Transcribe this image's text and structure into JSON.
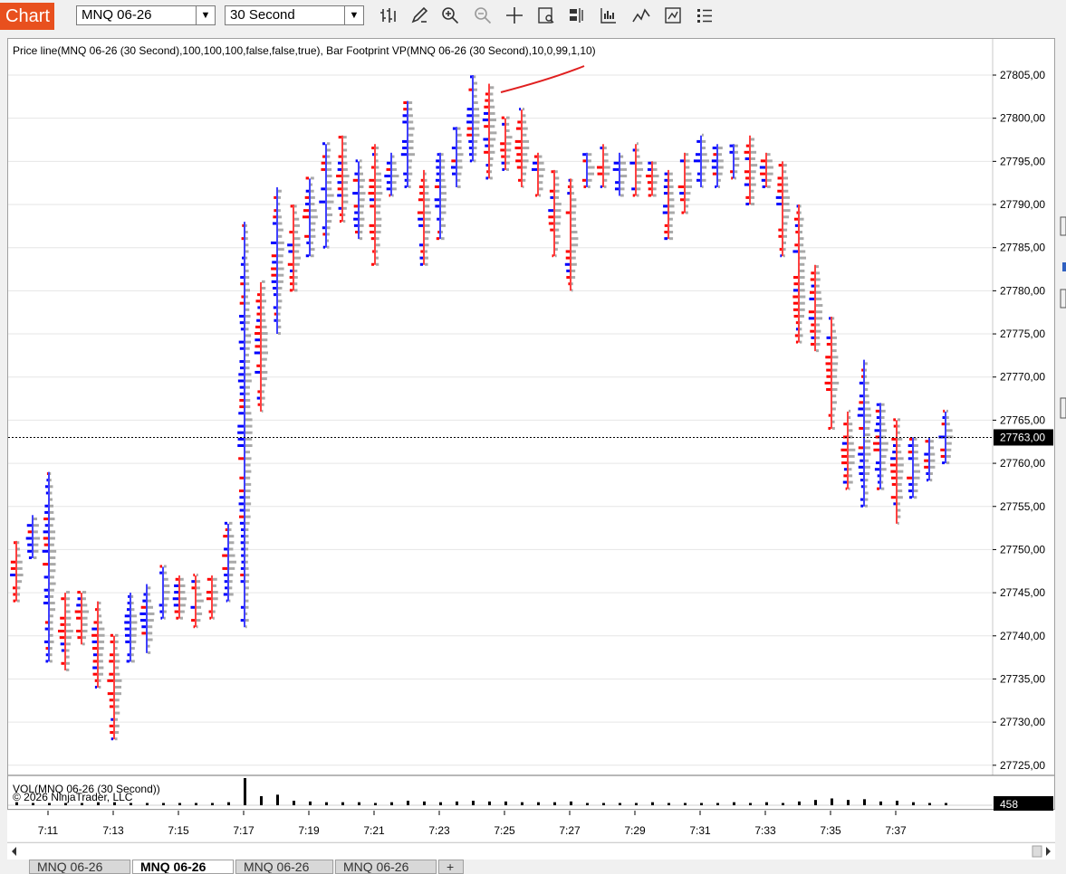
{
  "toolbar": {
    "chart_tab": "Chart",
    "instrument": "MNQ 06-26",
    "interval": "30 Second"
  },
  "indicator_label": "Price line(MNQ 06-26 (30 Second),100,100,100,false,false,true), Bar Footprint VP(MNQ 06-26 (30 Second),10,0,99,1,10)",
  "volume_label": "VOL(MNQ 06-26 (30 Second))",
  "copyright": "© 2026 NinjaTrader, LLC",
  "colors": {
    "bid": "#ff0000",
    "ask": "#0000ff",
    "neutral": "#a9a9a9",
    "price_tag_bg": "#000000",
    "app_accent": "#e8501e"
  },
  "chart_data": {
    "type": "bar",
    "title": "",
    "current_price": 27763.0,
    "current_price_label": "27763,00",
    "ylim": [
      27723,
      27808
    ],
    "y_ticks": [
      "27805,00",
      "27800,00",
      "27795,00",
      "27790,00",
      "27785,00",
      "27780,00",
      "27775,00",
      "27770,00",
      "27765,00",
      "27760,00",
      "27755,00",
      "27750,00",
      "27745,00",
      "27740,00",
      "27735,00",
      "27730,00",
      "27725,00"
    ],
    "x_ticks": [
      "7:11",
      "7:13",
      "7:15",
      "7:17",
      "7:19",
      "7:21",
      "7:23",
      "7:25",
      "7:27",
      "7:29",
      "7:31",
      "7:33",
      "7:35",
      "7:37"
    ],
    "volume_value_label": "458",
    "bars": [
      {
        "t": "7:10.0",
        "low": 27744,
        "high": 27751,
        "dir": "dn"
      },
      {
        "t": "7:10.5",
        "low": 27749,
        "high": 27754,
        "dir": "up"
      },
      {
        "t": "7:11.0",
        "low": 27737,
        "high": 27759,
        "dir": "up"
      },
      {
        "t": "7:11.5",
        "low": 27736,
        "high": 27745,
        "dir": "dn"
      },
      {
        "t": "7:12.0",
        "low": 27739,
        "high": 27745,
        "dir": "dn"
      },
      {
        "t": "7:12.5",
        "low": 27734,
        "high": 27744,
        "dir": "dn"
      },
      {
        "t": "7:13.0",
        "low": 27728,
        "high": 27740,
        "dir": "dn"
      },
      {
        "t": "7:13.5",
        "low": 27737,
        "high": 27745,
        "dir": "up"
      },
      {
        "t": "7:14.0",
        "low": 27738,
        "high": 27746,
        "dir": "up"
      },
      {
        "t": "7:14.5",
        "low": 27742,
        "high": 27748,
        "dir": "up"
      },
      {
        "t": "7:15.0",
        "low": 27742,
        "high": 27747,
        "dir": "dn"
      },
      {
        "t": "7:15.5",
        "low": 27741,
        "high": 27747,
        "dir": "dn"
      },
      {
        "t": "7:16.0",
        "low": 27742,
        "high": 27747,
        "dir": "dn"
      },
      {
        "t": "7:16.5",
        "low": 27744,
        "high": 27753,
        "dir": "up"
      },
      {
        "t": "7:17.0",
        "low": 27741,
        "high": 27788,
        "dir": "up"
      },
      {
        "t": "7:17.5",
        "low": 27766,
        "high": 27781,
        "dir": "dn"
      },
      {
        "t": "7:18.0",
        "low": 27775,
        "high": 27792,
        "dir": "up"
      },
      {
        "t": "7:18.5",
        "low": 27780,
        "high": 27790,
        "dir": "dn"
      },
      {
        "t": "7:19.0",
        "low": 27784,
        "high": 27793,
        "dir": "up"
      },
      {
        "t": "7:19.5",
        "low": 27785,
        "high": 27797,
        "dir": "up"
      },
      {
        "t": "7:20.0",
        "low": 27788,
        "high": 27798,
        "dir": "dn"
      },
      {
        "t": "7:20.5",
        "low": 27786,
        "high": 27795,
        "dir": "up"
      },
      {
        "t": "7:21.0",
        "low": 27783,
        "high": 27797,
        "dir": "dn"
      },
      {
        "t": "7:21.5",
        "low": 27791,
        "high": 27796,
        "dir": "up"
      },
      {
        "t": "7:22.0",
        "low": 27792,
        "high": 27802,
        "dir": "up"
      },
      {
        "t": "7:22.5",
        "low": 27783,
        "high": 27794,
        "dir": "dn"
      },
      {
        "t": "7:23.0",
        "low": 27786,
        "high": 27796,
        "dir": "up"
      },
      {
        "t": "7:23.5",
        "low": 27792,
        "high": 27799,
        "dir": "up"
      },
      {
        "t": "7:24.0",
        "low": 27795,
        "high": 27805,
        "dir": "up"
      },
      {
        "t": "7:24.5",
        "low": 27793,
        "high": 27804,
        "dir": "dn"
      },
      {
        "t": "7:25.0",
        "low": 27794,
        "high": 27800,
        "dir": "dn"
      },
      {
        "t": "7:25.5",
        "low": 27792,
        "high": 27801,
        "dir": "dn"
      },
      {
        "t": "7:26.0",
        "low": 27791,
        "high": 27796,
        "dir": "dn"
      },
      {
        "t": "7:26.5",
        "low": 27784,
        "high": 27794,
        "dir": "dn"
      },
      {
        "t": "7:27.0",
        "low": 27780,
        "high": 27793,
        "dir": "dn"
      },
      {
        "t": "7:27.5",
        "low": 27792,
        "high": 27796,
        "dir": "up"
      },
      {
        "t": "7:28.0",
        "low": 27792,
        "high": 27797,
        "dir": "dn"
      },
      {
        "t": "7:28.5",
        "low": 27791,
        "high": 27796,
        "dir": "up"
      },
      {
        "t": "7:29.0",
        "low": 27791,
        "high": 27797,
        "dir": "dn"
      },
      {
        "t": "7:29.5",
        "low": 27791,
        "high": 27795,
        "dir": "dn"
      },
      {
        "t": "7:30.0",
        "low": 27786,
        "high": 27794,
        "dir": "dn"
      },
      {
        "t": "7:30.5",
        "low": 27789,
        "high": 27796,
        "dir": "dn"
      },
      {
        "t": "7:31.0",
        "low": 27792,
        "high": 27798,
        "dir": "up"
      },
      {
        "t": "7:31.5",
        "low": 27792,
        "high": 27797,
        "dir": "up"
      },
      {
        "t": "7:32.0",
        "low": 27793,
        "high": 27797,
        "dir": "up"
      },
      {
        "t": "7:32.5",
        "low": 27790,
        "high": 27798,
        "dir": "dn"
      },
      {
        "t": "7:33.0",
        "low": 27792,
        "high": 27796,
        "dir": "dn"
      },
      {
        "t": "7:33.5",
        "low": 27784,
        "high": 27795,
        "dir": "dn"
      },
      {
        "t": "7:34.0",
        "low": 27774,
        "high": 27790,
        "dir": "dn"
      },
      {
        "t": "7:34.5",
        "low": 27773,
        "high": 27783,
        "dir": "dn"
      },
      {
        "t": "7:35.0",
        "low": 27764,
        "high": 27777,
        "dir": "dn"
      },
      {
        "t": "7:35.5",
        "low": 27757,
        "high": 27766,
        "dir": "dn"
      },
      {
        "t": "7:36.0",
        "low": 27755,
        "high": 27772,
        "dir": "up"
      },
      {
        "t": "7:36.5",
        "low": 27757,
        "high": 27767,
        "dir": "up"
      },
      {
        "t": "7:37.0",
        "low": 27753,
        "high": 27765,
        "dir": "dn"
      },
      {
        "t": "7:37.5",
        "low": 27756,
        "high": 27763,
        "dir": "up"
      },
      {
        "t": "7:38.0",
        "low": 27758,
        "high": 27763,
        "dir": "up"
      },
      {
        "t": "7:38.5",
        "low": 27760,
        "high": 27766,
        "dir": "up"
      }
    ],
    "volumes": [
      4,
      3,
      3,
      3,
      3,
      4,
      4,
      3,
      3,
      3,
      3,
      3,
      3,
      4,
      36,
      12,
      14,
      6,
      5,
      4,
      4,
      4,
      3,
      4,
      6,
      5,
      4,
      5,
      6,
      5,
      5,
      4,
      4,
      4,
      5,
      3,
      3,
      3,
      3,
      4,
      3,
      3,
      3,
      3,
      4,
      3,
      4,
      3,
      5,
      7,
      9,
      7,
      8,
      5,
      6,
      4,
      3,
      3
    ]
  }
}
